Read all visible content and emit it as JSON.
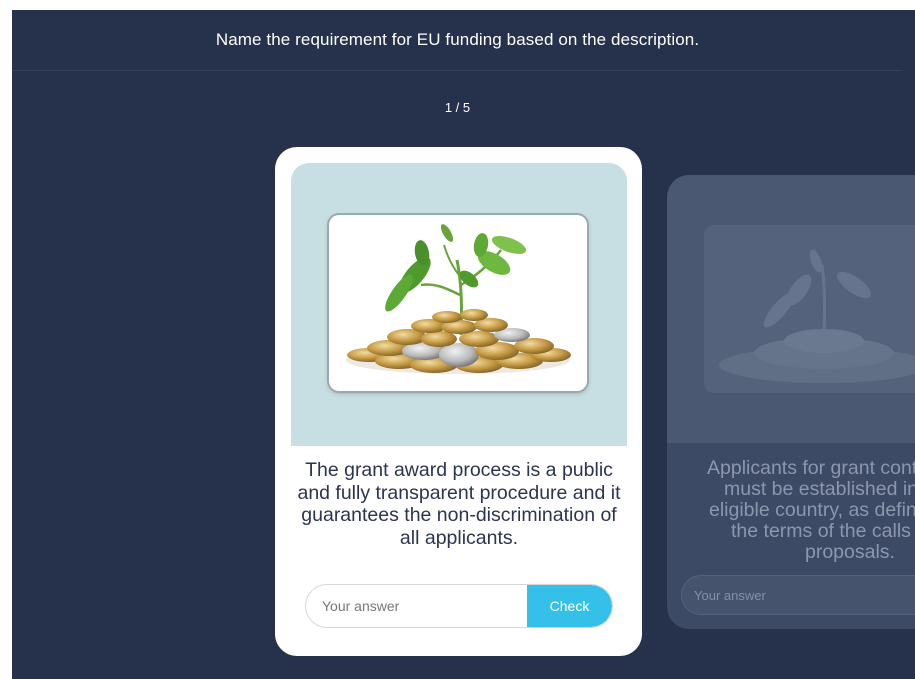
{
  "header": {
    "instruction": "Name the requirement for EU funding based on the description."
  },
  "progress": {
    "counter": "1 / 5",
    "current": 1,
    "total": 5
  },
  "cards": [
    {
      "image": "plant-growing-from-coins",
      "description": "The grant award process is a public and fully transparent procedure and it guarantees the non-discrimination of all applicants.",
      "answer_placeholder": "Your answer",
      "check_label": "Check"
    },
    {
      "image": "plant-growing-from-coins",
      "description_lines": [
        "Applicants for grant cont",
        "must be established in",
        "eligible country, as defin",
        "the terms of the calls f",
        "proposals."
      ],
      "answer_placeholder": "Your answer"
    }
  ],
  "colors": {
    "background": "#26324c",
    "card": "#ffffff",
    "media": "#c7dfe2",
    "accent": "#35c0ea",
    "text": "#2b3550"
  }
}
